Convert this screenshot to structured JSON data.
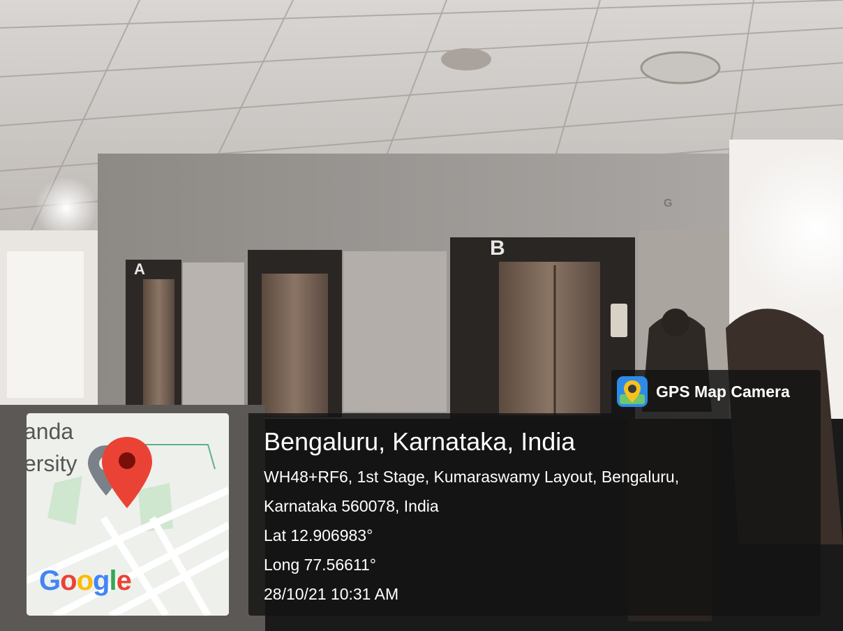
{
  "badge": {
    "app_name": "GPS Map Camera",
    "icon": "gps-map-camera-app-icon"
  },
  "location": {
    "city_line": "Bengaluru, Karnataka, India",
    "address_line1": "WH48+RF6, 1st Stage, Kumaraswamy Layout, Bengaluru,",
    "address_line2": "Karnataka 560078, India",
    "lat": "Lat 12.906983°",
    "long": "Long 77.56611°",
    "datetime": "28/10/21 10:31 AM"
  },
  "map": {
    "label_top": "anda",
    "label_bottom": "ersity",
    "google_letters": [
      "G",
      "o",
      "o",
      "g",
      "l",
      "e"
    ],
    "google_colors": [
      "#4285F4",
      "#EA4335",
      "#FBBC05",
      "#4285F4",
      "#34A853",
      "#EA4335"
    ],
    "pin_color": "#EA4335"
  },
  "photo": {
    "lift_labels": [
      "A",
      "B",
      "G"
    ]
  }
}
